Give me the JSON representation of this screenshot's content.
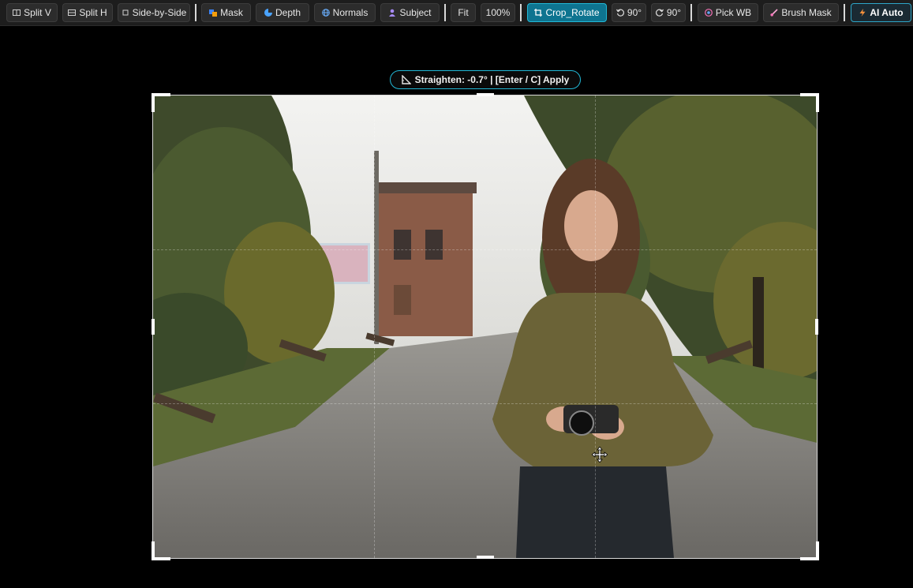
{
  "toolbar": {
    "split_v": "Split V",
    "split_h": "Split H",
    "side_by_side": "Side-by-Side",
    "mask": "Mask",
    "depth": "Depth",
    "normals": "Normals",
    "subject": "Subject",
    "fit": "Fit",
    "zoom": "100%",
    "crop_rotate": "Crop_Rotate",
    "rotate_ccw": "90°",
    "rotate_cw": "90°",
    "pick_wb": "Pick WB",
    "brush_mask": "Brush Mask",
    "ai_auto": "AI Auto"
  },
  "crop": {
    "straighten_label": "Straighten: -0.7°  |  [Enter / C] Apply"
  },
  "colors": {
    "accent": "#22b8d6",
    "active_bg": "#0e7490",
    "toolbar_bg": "#1d1d1d",
    "canvas_bg": "#000000"
  },
  "icons": {
    "split_v": "split-vertical-icon",
    "split_h": "split-horizontal-icon",
    "side_by_side": "side-by-side-icon",
    "mask": "mask-icon",
    "depth": "depth-icon",
    "normals": "globe-icon",
    "subject": "person-icon",
    "crop": "crop-icon",
    "rotate_ccw": "rotate-ccw-icon",
    "rotate_cw": "rotate-cw-icon",
    "pick_wb": "eyedropper-icon",
    "brush": "brush-icon",
    "ai": "lightning-icon",
    "straighten": "ruler-triangle-icon",
    "move": "move-cursor-icon"
  }
}
